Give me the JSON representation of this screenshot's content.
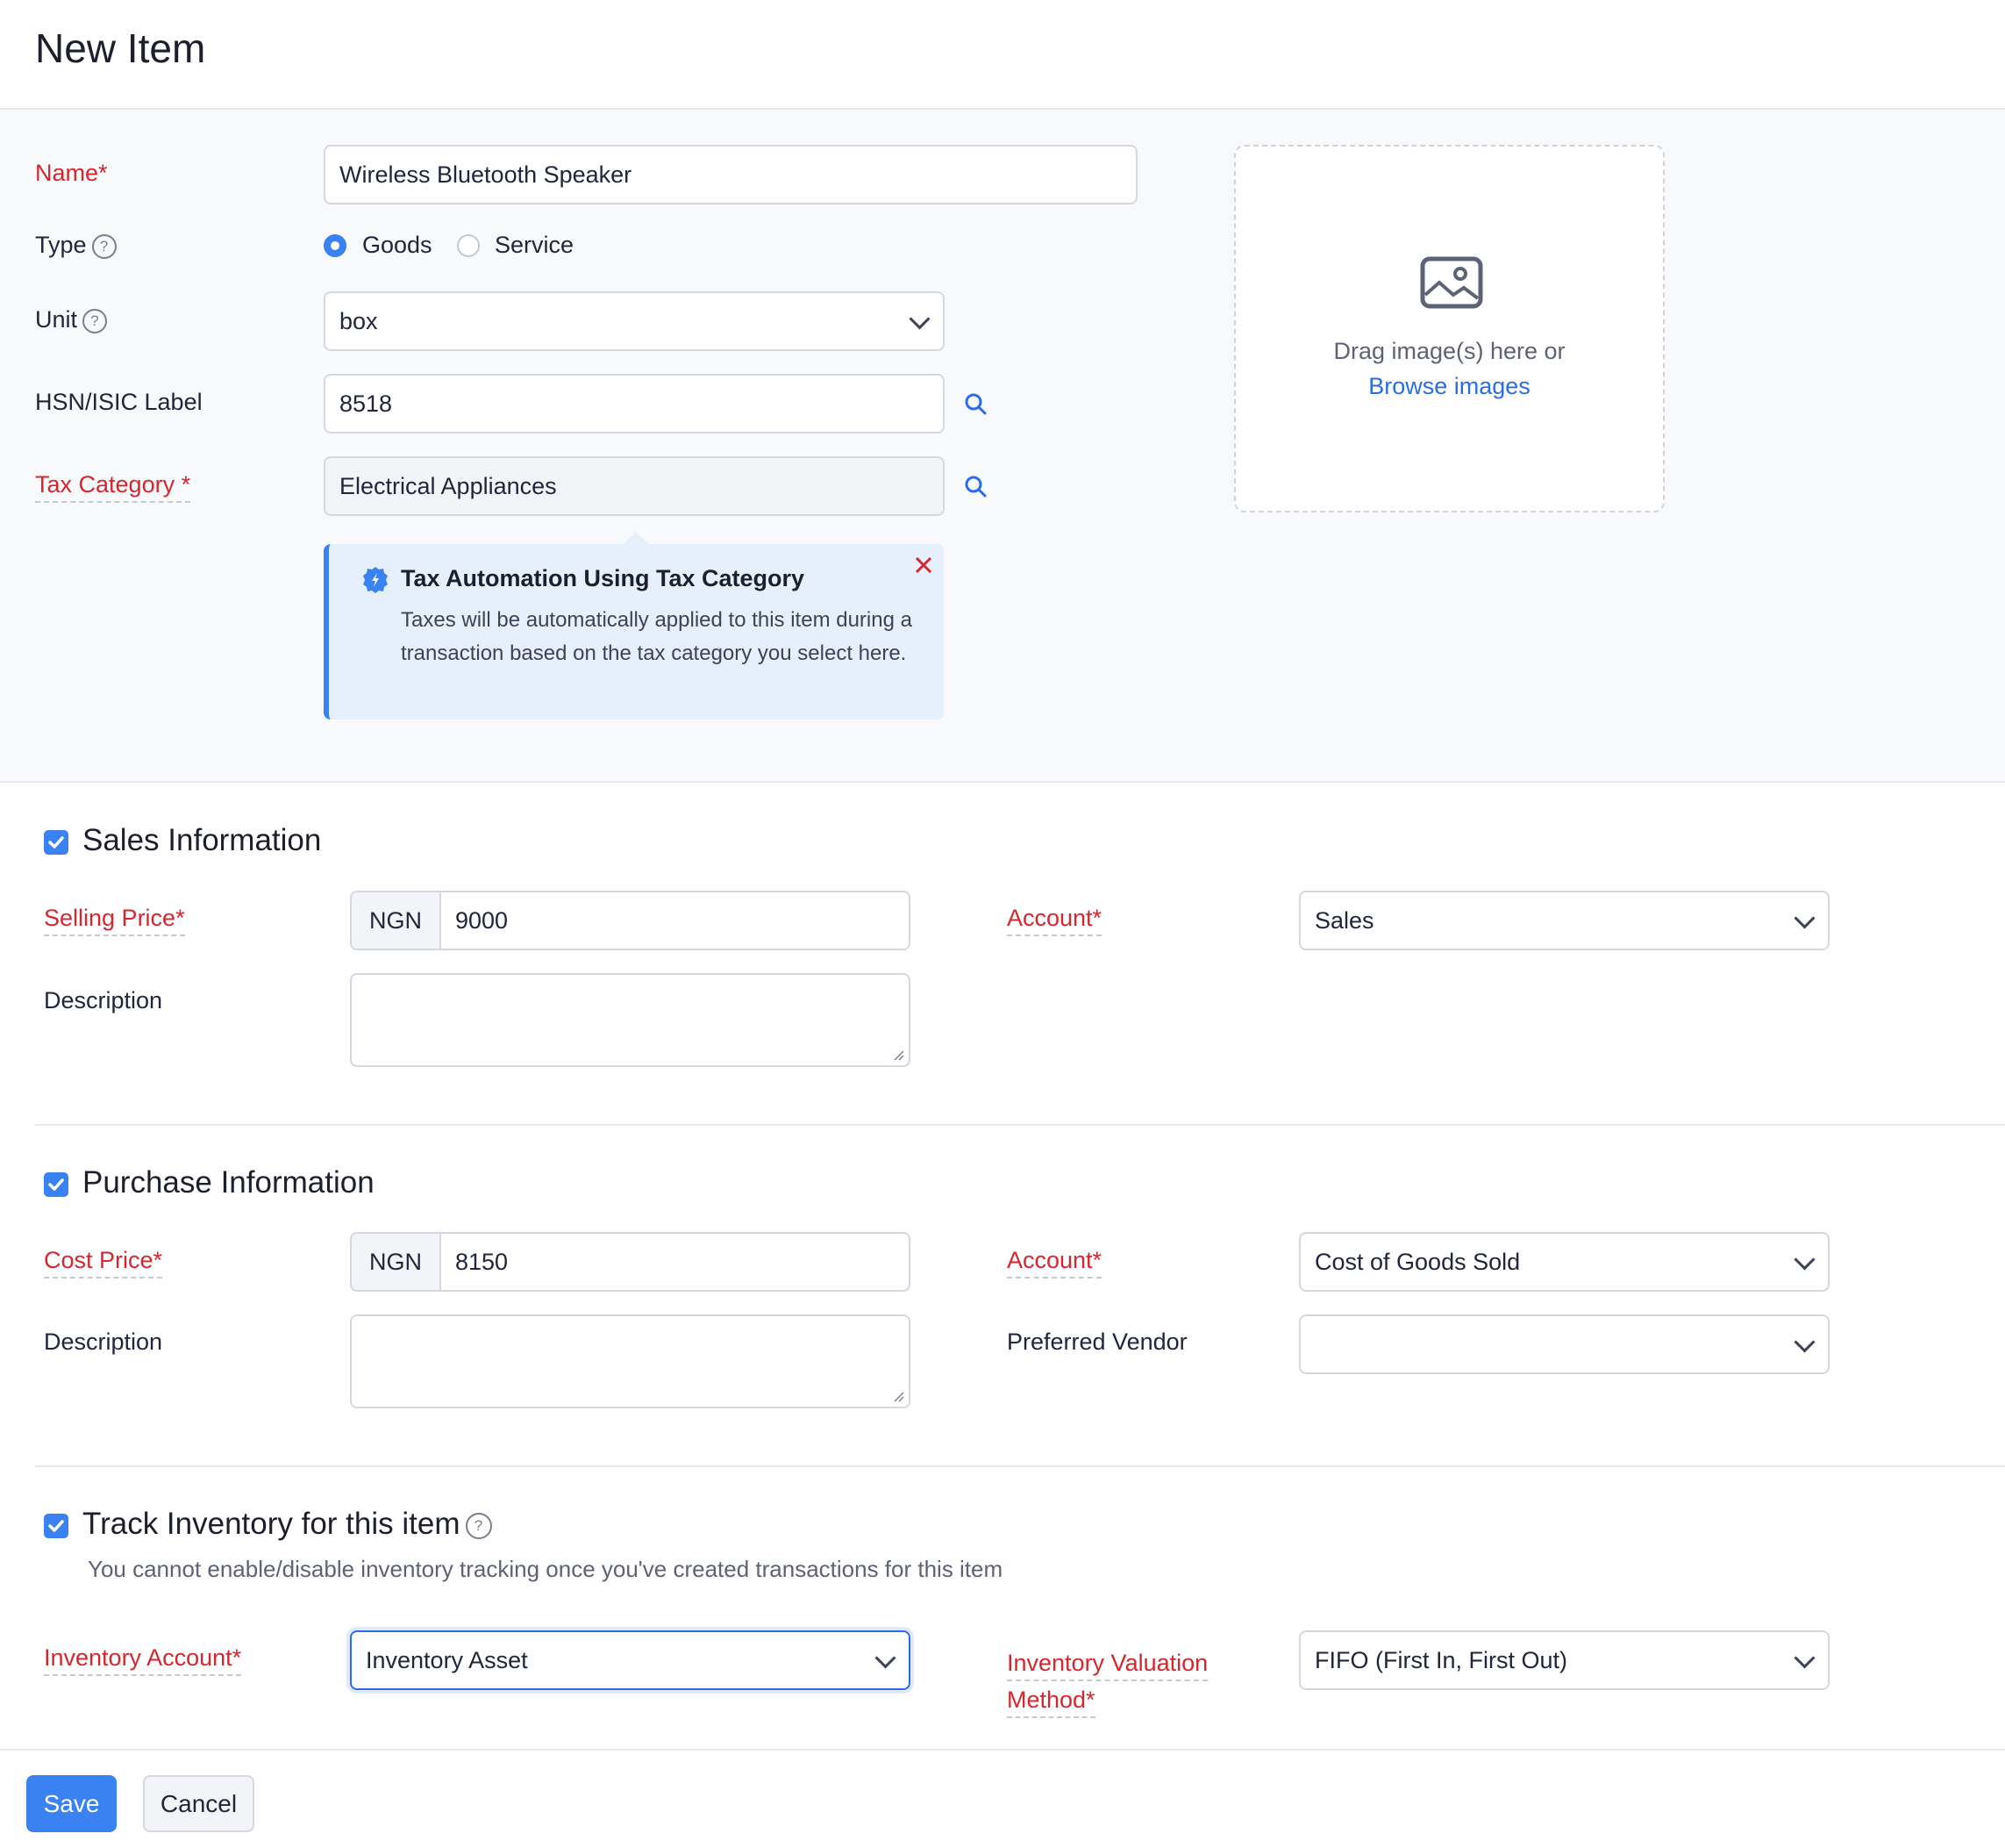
{
  "page": {
    "title": "New Item"
  },
  "form": {
    "name": {
      "label": "Name*",
      "value": "Wireless Bluetooth Speaker"
    },
    "type": {
      "label": "Type",
      "help": "?",
      "options": [
        "Goods",
        "Service"
      ],
      "selected": "Goods"
    },
    "unit": {
      "label": "Unit",
      "help": "?",
      "value": "box"
    },
    "hsn": {
      "label": "HSN/ISIC Label",
      "value": "8518"
    },
    "tax_category": {
      "label": "Tax Category *",
      "value": "Electrical Appliances"
    }
  },
  "tax_info": {
    "title": "Tax Automation Using Tax Category",
    "body": "Taxes will be automatically applied to this item during a transaction based on the tax category you select here."
  },
  "image_upload": {
    "drag_text": "Drag image(s) here or",
    "browse_text": "Browse images"
  },
  "sales": {
    "heading": "Sales Information",
    "checked": true,
    "price_label": "Selling Price*",
    "currency": "NGN",
    "price": "9000",
    "account_label": "Account*",
    "account": "Sales",
    "description_label": "Description"
  },
  "purchase": {
    "heading": "Purchase Information",
    "checked": true,
    "price_label": "Cost Price*",
    "currency": "NGN",
    "price": "8150",
    "account_label": "Account*",
    "account": "Cost of Goods Sold",
    "description_label": "Description",
    "vendor_label": "Preferred Vendor",
    "vendor": ""
  },
  "inventory": {
    "heading": "Track Inventory for this item",
    "help": "?",
    "checked": true,
    "note": "You cannot enable/disable inventory tracking once you've created transactions for this item",
    "account_label": "Inventory Account*",
    "account": "Inventory Asset",
    "valuation_label_line1": "Inventory Valuation",
    "valuation_label_line2": "Method*",
    "valuation": "FIFO (First In, First Out)"
  },
  "footer": {
    "save": "Save",
    "cancel": "Cancel"
  },
  "colors": {
    "accent": "#3a82f1",
    "required": "#d6262e",
    "info_bg": "#e6f0fd"
  }
}
